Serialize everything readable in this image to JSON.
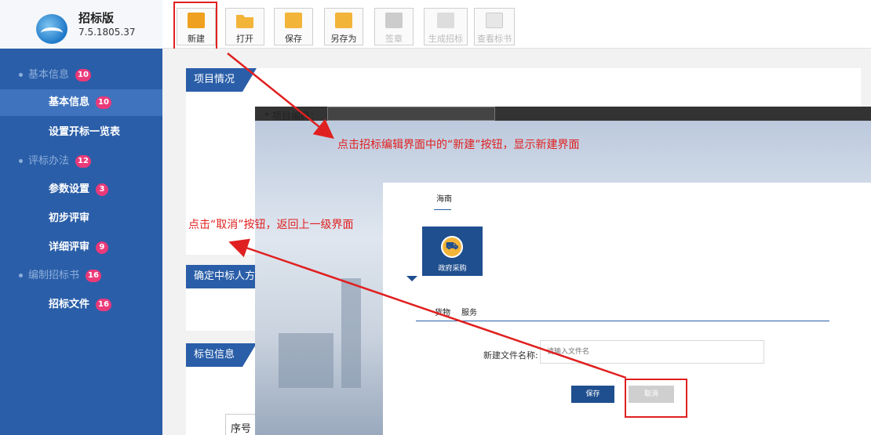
{
  "app": {
    "title": "招标版",
    "version": "7.5.1805.37"
  },
  "toolbar": {
    "new": "新建",
    "open": "打开",
    "save": "保存",
    "save_as": "另存为",
    "sign": "签章",
    "generate": "生成招标书",
    "view": "查看标书"
  },
  "sidebar": {
    "basic_group": {
      "label": "基本信息",
      "count": "10"
    },
    "basic_info": {
      "label": "基本信息",
      "count": "10"
    },
    "opening_table": "设置开标一览表",
    "eval_group": {
      "label": "评标办法",
      "count": "12"
    },
    "params": {
      "label": "参数设置",
      "count": "3"
    },
    "prelim": "初步评审",
    "detail": {
      "label": "详细评审",
      "count": "9"
    },
    "compile_group": {
      "label": "编制招标书",
      "count": "16"
    },
    "bid_file": {
      "label": "招标文件",
      "count": "16"
    }
  },
  "main": {
    "project_tab": "项目情况",
    "winner_tab": "确定中标人方法",
    "package_tab": "标包信息",
    "seq_header": "序号"
  },
  "dialog": {
    "project_code_label": "* 项目编码：",
    "region_tab": "海南",
    "category_tile": "政府采购",
    "sub_tabs": [
      "货物",
      "服务"
    ],
    "filename_label": "新建文件名称:",
    "filename_placeholder": "请输入文件名",
    "save_button": "保存",
    "cancel_button": "取消"
  },
  "annotations": {
    "new_note": "点击招标编辑界面中的“新建”按钮，显示新建界面",
    "cancel_note": "点击“取消”按钮，返回上一级界面"
  },
  "colors": {
    "sidebar": "#2a5ea8",
    "accent": "#1f4f8f",
    "badge": "#ea3a7a",
    "highlight": "#e02020"
  }
}
